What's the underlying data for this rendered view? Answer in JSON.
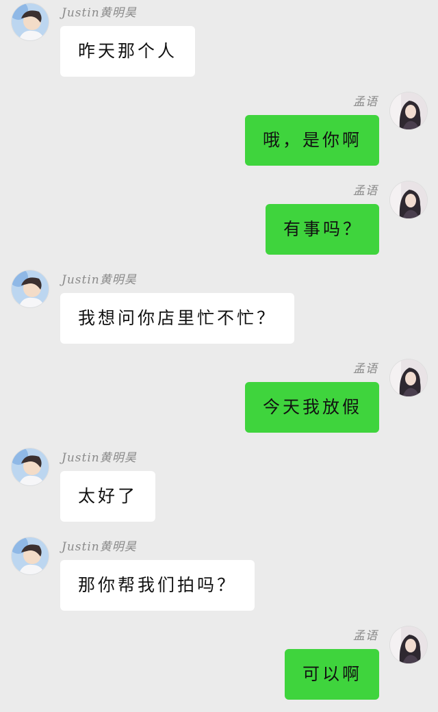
{
  "conversation": {
    "messages": [
      {
        "side": "left",
        "sender": "Justin黄明昊",
        "text": "昨天那个人"
      },
      {
        "side": "right",
        "sender": "孟语",
        "text": "哦，是你啊"
      },
      {
        "side": "right",
        "sender": "孟语",
        "text": "有事吗？"
      },
      {
        "side": "left",
        "sender": "Justin黄明昊",
        "text": "我想问你店里忙不忙？"
      },
      {
        "side": "right",
        "sender": "孟语",
        "text": "今天我放假"
      },
      {
        "side": "left",
        "sender": "Justin黄明昊",
        "text": "太好了"
      },
      {
        "side": "left",
        "sender": "Justin黄明昊",
        "text": "那你帮我们拍吗？"
      },
      {
        "side": "right",
        "sender": "孟语",
        "text": "可以啊"
      }
    ]
  },
  "colors": {
    "background": "#ebebeb",
    "incoming_bubble": "#ffffff",
    "outgoing_bubble": "#3fd43d",
    "sender_name": "#8a8a8a"
  },
  "icons": {
    "incoming_avatar": "justin-avatar-icon",
    "outgoing_avatar": "mengyu-avatar-icon"
  }
}
